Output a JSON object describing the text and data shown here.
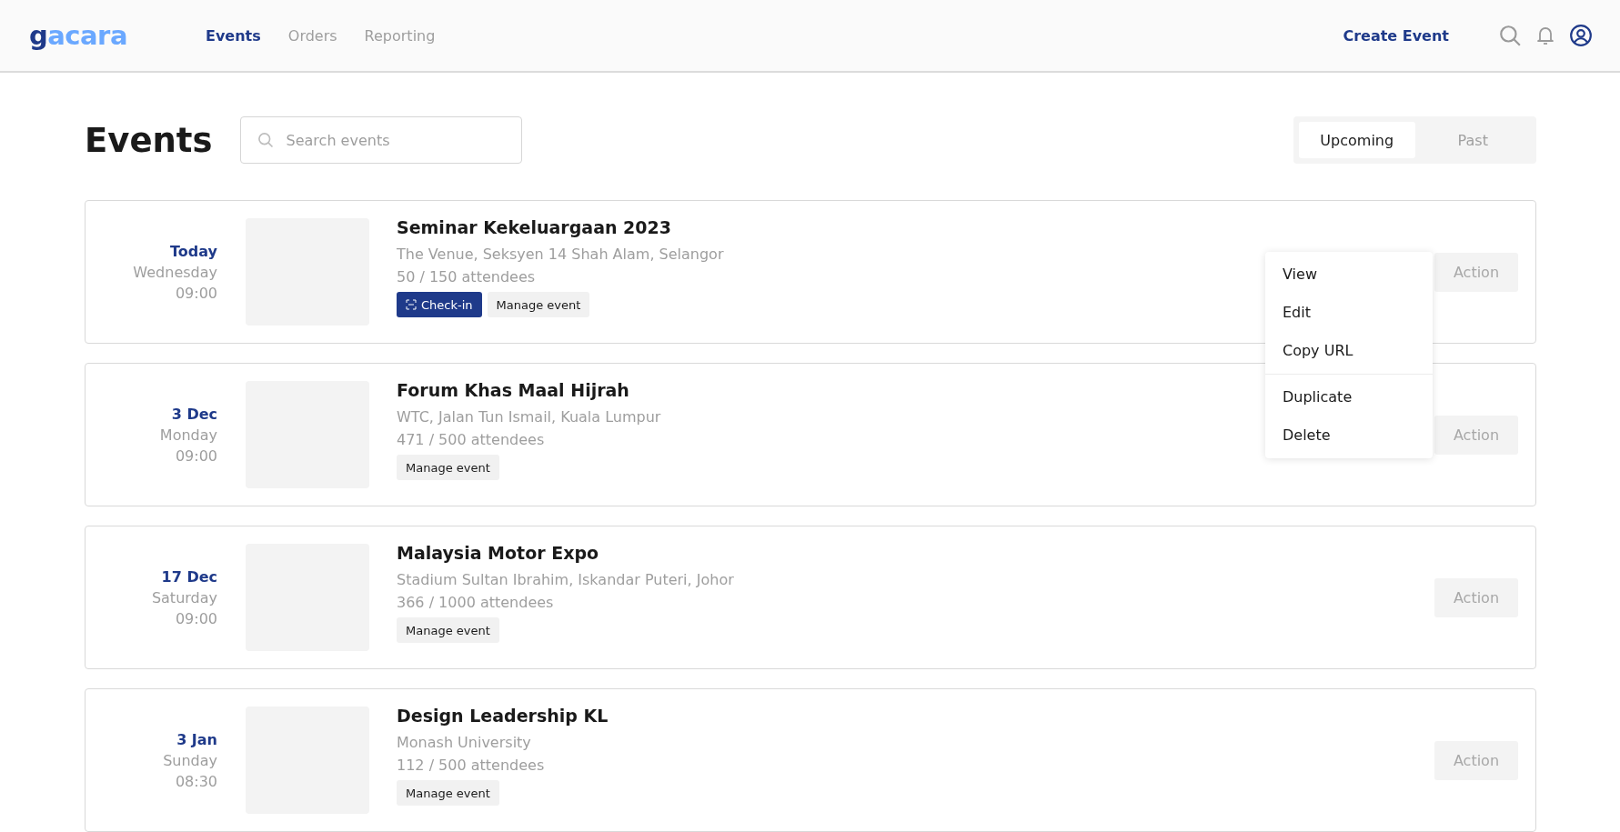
{
  "logo": {
    "first": "g",
    "rest": "acara"
  },
  "nav": [
    {
      "label": "Events",
      "selected": true
    },
    {
      "label": "Orders",
      "selected": false
    },
    {
      "label": "Reporting",
      "selected": false
    }
  ],
  "create_button": "Create Event",
  "page_title": "Events",
  "search": {
    "placeholder": "Search events"
  },
  "tabs": [
    {
      "label": "Upcoming",
      "selected": true
    },
    {
      "label": "Past",
      "selected": false
    }
  ],
  "events": [
    {
      "day": "Today",
      "weekday": "Wednesday",
      "time": "09:00",
      "title": "Seminar Kekeluargaan 2023",
      "venue": "The Venue, Seksyen 14 Shah Alam, Selangor",
      "attendees": "50 / 150 attendees",
      "buttons": [
        {
          "kind": "checkin",
          "label": "Check-in"
        },
        {
          "kind": "manage",
          "label": "Manage event"
        }
      ],
      "action": "Action",
      "menu_open": true
    },
    {
      "day": "3 Dec",
      "weekday": "Monday",
      "time": "09:00",
      "title": "Forum Khas Maal Hijrah",
      "venue": "WTC, Jalan Tun Ismail, Kuala Lumpur",
      "attendees": "471 / 500 attendees",
      "buttons": [
        {
          "kind": "manage",
          "label": "Manage event"
        }
      ],
      "action": "Action",
      "menu_open": false
    },
    {
      "day": "17 Dec",
      "weekday": "Saturday",
      "time": "09:00",
      "title": "Malaysia Motor Expo",
      "venue": "Stadium Sultan Ibrahim, Iskandar Puteri, Johor",
      "attendees": "366 / 1000 attendees",
      "buttons": [
        {
          "kind": "manage",
          "label": "Manage event"
        }
      ],
      "action": "Action",
      "menu_open": false
    },
    {
      "day": "3 Jan",
      "weekday": "Sunday",
      "time": "08:30",
      "title": "Design Leadership KL",
      "venue": "Monash University",
      "attendees": "112 / 500 attendees",
      "buttons": [
        {
          "kind": "manage",
          "label": "Manage event"
        }
      ],
      "action": "Action",
      "menu_open": false
    }
  ],
  "action_menu": {
    "sections": [
      [
        "View",
        "Edit",
        "Copy URL"
      ],
      [
        "Duplicate",
        "Delete"
      ]
    ]
  }
}
